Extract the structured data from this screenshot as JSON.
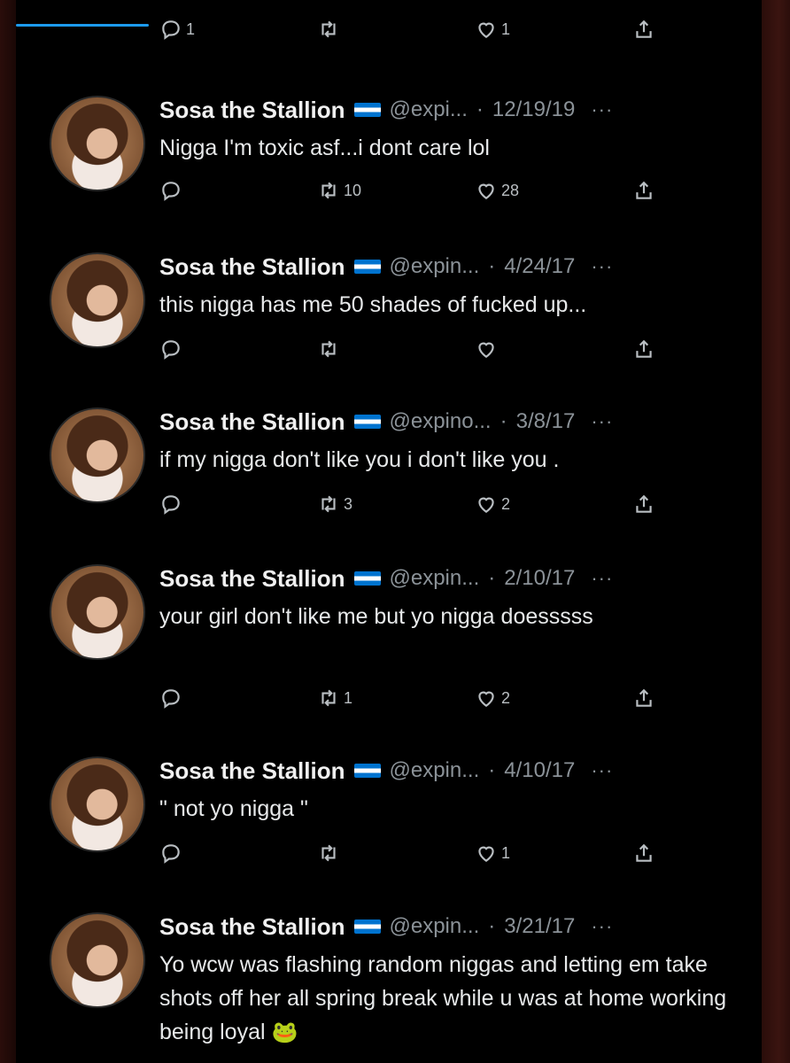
{
  "top_actions": {
    "reply_count": "1",
    "retweet_count": "",
    "like_count": "1"
  },
  "tweets": [
    {
      "name": "Sosa the Stallion",
      "handle": "@expi...",
      "date": "12/19/19",
      "text": "Nigga I'm toxic asf...i dont care lol",
      "reply_count": "",
      "retweet_count": "10",
      "like_count": "28"
    },
    {
      "name": "Sosa the Stallion",
      "handle": "@expin...",
      "date": "4/24/17",
      "text": "this nigga has me 50 shades of fucked up...",
      "reply_count": "",
      "retweet_count": "",
      "like_count": ""
    },
    {
      "name": "Sosa the Stallion",
      "handle": "@expino...",
      "date": "3/8/17",
      "text": "if my nigga don't like you i don't like you .",
      "reply_count": "",
      "retweet_count": "3",
      "like_count": "2"
    },
    {
      "name": "Sosa the Stallion",
      "handle": "@expin...",
      "date": "2/10/17",
      "text": "your girl don't like me but yo nigga doesssss",
      "reply_count": "",
      "retweet_count": "1",
      "like_count": "2"
    },
    {
      "name": "Sosa the Stallion",
      "handle": "@expin...",
      "date": "4/10/17",
      "text": "\" not yo nigga \"",
      "reply_count": "",
      "retweet_count": "",
      "like_count": "1"
    },
    {
      "name": "Sosa the Stallion",
      "handle": "@expin...",
      "date": "3/21/17",
      "text": "Yo wcw was flashing random niggas and letting em take shots off her all spring break while u was at home working being loyal",
      "emoji": "🐸"
    }
  ],
  "more_label": "···",
  "separator": "·",
  "colors": {
    "background": "#000000",
    "accent": "#1d9bf0",
    "flag_blue": "#0073cf"
  },
  "icons": [
    "reply-icon",
    "retweet-icon",
    "like-icon",
    "share-icon",
    "more-icon",
    "flag-icon",
    "avatar"
  ]
}
